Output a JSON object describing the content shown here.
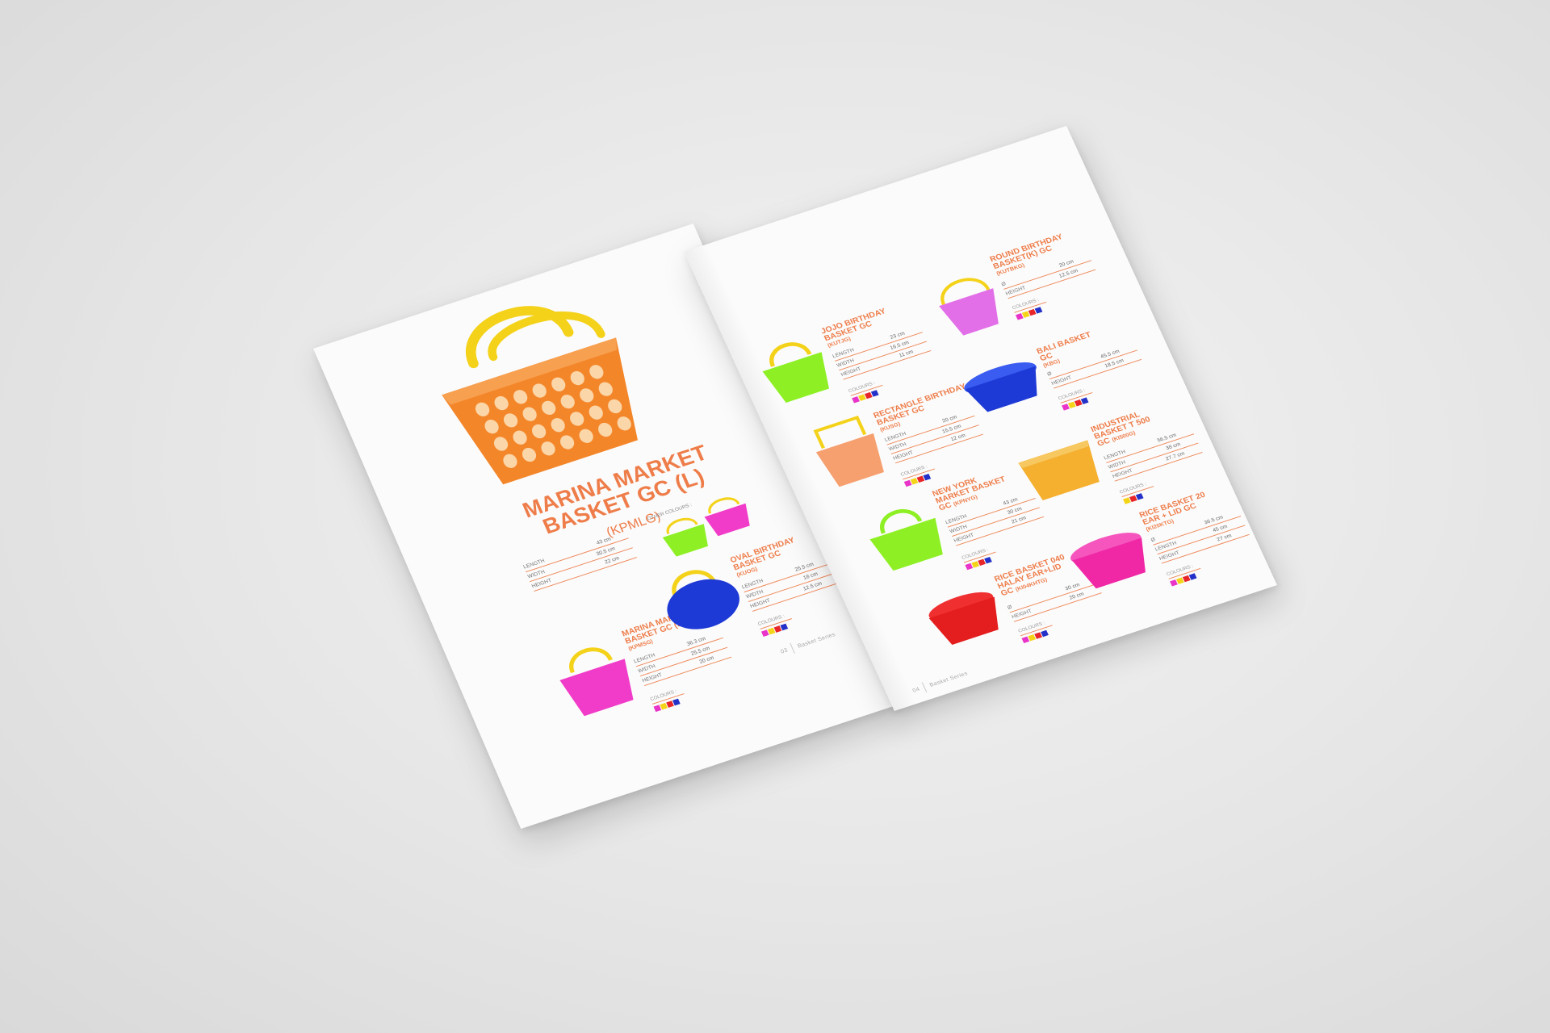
{
  "colors": {
    "accent": "#ee7d4a",
    "swatch_pink": "#e834c8",
    "swatch_yellow": "#f5d418",
    "swatch_red": "#e8262a",
    "swatch_blue": "#2331c8",
    "orange": "#f4862a",
    "green": "#8ef024",
    "pink": "#f03cc8",
    "blue": "#1e3ad6",
    "peach": "#f6a070",
    "amber": "#f5b030",
    "red": "#e41e1e",
    "magenta": "#f028a6",
    "violet": "#e26ee8",
    "handle": "#f4d21a"
  },
  "left_page": {
    "hero": {
      "title_line1": "MARINA MARKET",
      "title_line2": "BASKET GC (L)",
      "code": "(KPMLG)",
      "other_colours_label": "OTHER COLOURS :",
      "specs": [
        {
          "label": "LENGTH",
          "value": "43 cm"
        },
        {
          "label": "WIDTH",
          "value": "30.5 cm"
        },
        {
          "label": "HEIGHT",
          "value": "22 cm"
        }
      ]
    },
    "products": [
      {
        "title_line1": "MARINA MARKET",
        "title_line2": "BASKET GC (S)",
        "code": "(KPMSG)",
        "specs": [
          {
            "label": "LENGTH",
            "value": "36.3 cm"
          },
          {
            "label": "WIDTH",
            "value": "25.5 cm"
          },
          {
            "label": "HEIGHT",
            "value": "20 cm"
          }
        ],
        "colours_label": "COLOURS :"
      },
      {
        "title_line1": "OVAL BIRTHDAY",
        "title_line2": "BASKET GC",
        "code": "(KUOG)",
        "specs": [
          {
            "label": "LENGTH",
            "value": "25.5 cm"
          },
          {
            "label": "WIDTH",
            "value": "18 cm"
          },
          {
            "label": "HEIGHT",
            "value": "12.5 cm"
          }
        ],
        "colours_label": "COLOURS :"
      }
    ],
    "footer": {
      "page_number": "03",
      "section": "Basket Series"
    }
  },
  "right_page": {
    "products": [
      {
        "title_line1": "JOJO BIRTHDAY",
        "title_line2": "BASKET  GC",
        "code": "(KUTJG)",
        "specs": [
          {
            "label": "LENGTH",
            "value": "23 cm"
          },
          {
            "label": "WIDTH",
            "value": "16.5 cm"
          },
          {
            "label": "HEIGHT",
            "value": "11 cm"
          }
        ],
        "colours_label": "COLOURS :"
      },
      {
        "title_line1": "ROUND BIRTHDAY",
        "title_line2": "BASKET(K) GC",
        "code": "(KUTBKG)",
        "specs": [
          {
            "label": "Ø",
            "value": "20 cm"
          },
          {
            "label": "HEIGHT",
            "value": "12.5 cm"
          }
        ],
        "colours_label": "COLOURS :"
      },
      {
        "title_line1": "RECTANGLE BIRTHDAY",
        "title_line2": "BASKET GC",
        "code": "(KUSG)",
        "specs": [
          {
            "label": "LENGTH",
            "value": "20 cm"
          },
          {
            "label": "WIDTH",
            "value": "15.5 cm"
          },
          {
            "label": "HEIGHT",
            "value": "12 cm"
          }
        ],
        "colours_label": "COLOURS :"
      },
      {
        "title_line1": "BALI BASKET",
        "title_line2": "GC",
        "code": "(KBG)",
        "specs": [
          {
            "label": "Ø",
            "value": "45.5 cm"
          },
          {
            "label": "HEIGHT",
            "value": "18.5 cm"
          }
        ],
        "colours_label": "COLOURS :"
      },
      {
        "title_line1": "NEW YORK",
        "title_line2": "MARKET BASKET",
        "title_line3": "GC",
        "code": "(KPNYG)",
        "specs": [
          {
            "label": "LENGTH",
            "value": "43 cm"
          },
          {
            "label": "WIDTH",
            "value": "30 cm"
          },
          {
            "label": "HEIGHT",
            "value": "21 cm"
          }
        ],
        "colours_label": "COLOURS :"
      },
      {
        "title_line1": "INDUSTRIAL",
        "title_line2": "BASKET T 500",
        "title_line3": "GC",
        "code": "(KI500G)",
        "specs": [
          {
            "label": "LENGTH",
            "value": "56.5 cm"
          },
          {
            "label": "WIDTH",
            "value": "38 cm"
          },
          {
            "label": "HEIGHT",
            "value": "27.7 cm"
          }
        ],
        "colours_label": "COLOURS :"
      },
      {
        "title_line1": "RICE BASKET 040",
        "title_line2": "HALAY EAR+LID",
        "title_line3": "GC",
        "code": "(KI04KHTG)",
        "specs": [
          {
            "label": "Ø",
            "value": "30 cm"
          },
          {
            "label": "HEIGHT",
            "value": "20 cm"
          }
        ],
        "colours_label": "COLOURS :"
      },
      {
        "title_line1": "RICE BASKET 20",
        "title_line2": "EAR + LID GC",
        "code": "(KI20KTG)",
        "specs": [
          {
            "label": "Ø",
            "value": "36.5 cm"
          },
          {
            "label": "LENGTH",
            "value": "45 cm"
          },
          {
            "label": "HEIGHT",
            "value": "27 cm"
          }
        ],
        "colours_label": "COLOURS :"
      }
    ],
    "footer": {
      "page_number": "04",
      "section": "Basket Series"
    }
  }
}
